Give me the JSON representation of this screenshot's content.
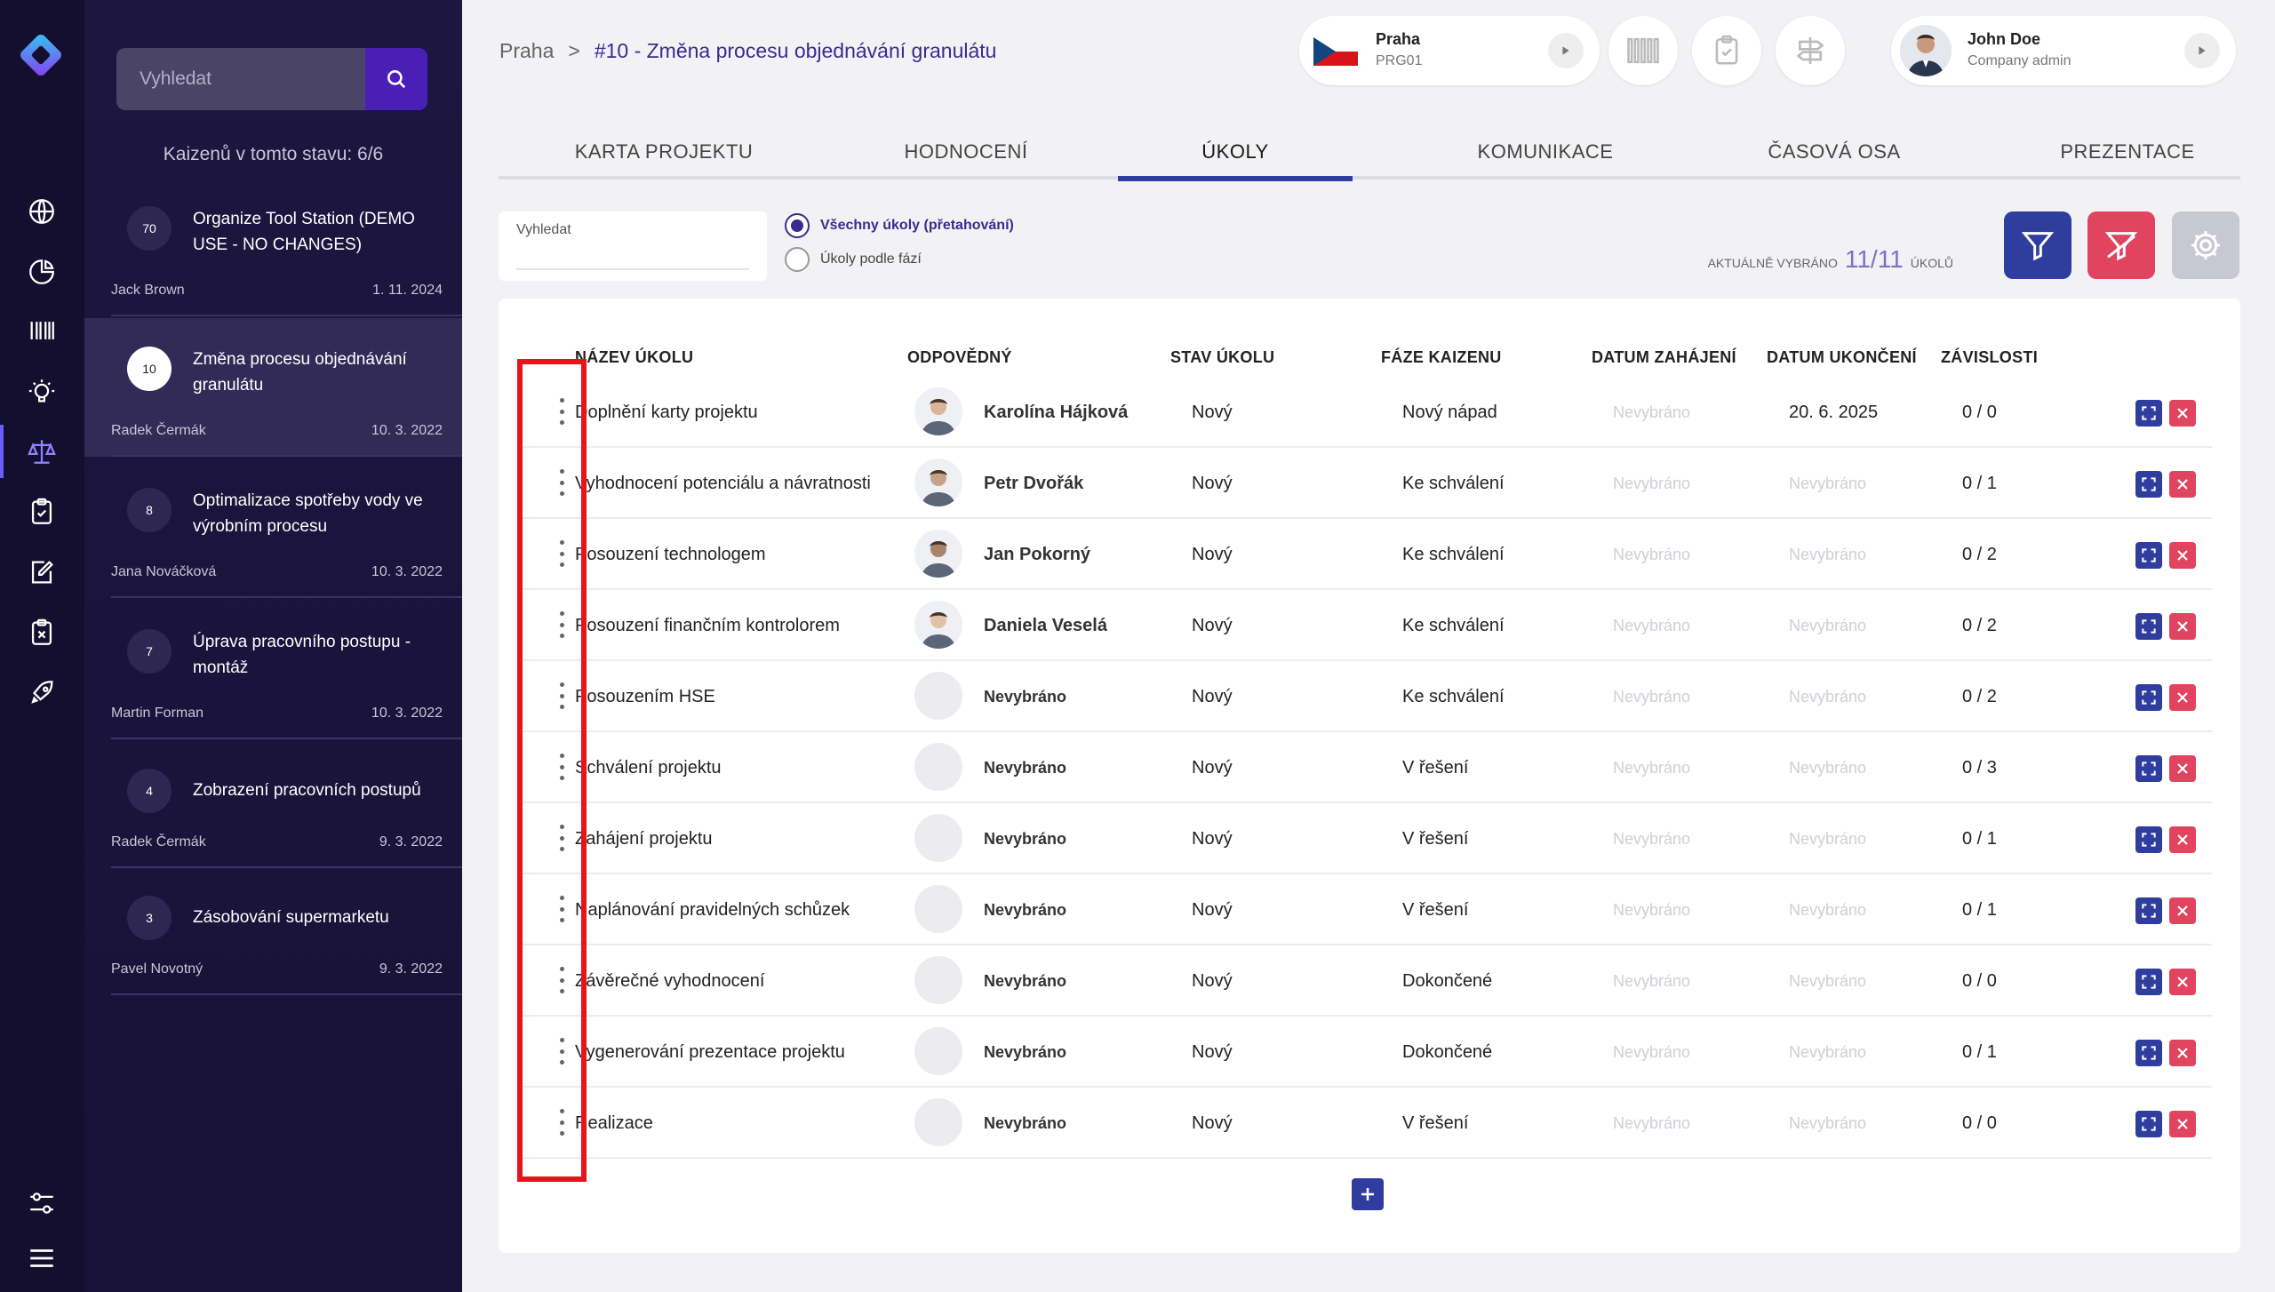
{
  "sidebar": {
    "search_placeholder": "Vyhledat",
    "count_text": "Kaizenů v tomto stavu: 6/6",
    "items": [
      {
        "number": "70",
        "title": "Organize Tool Station (DEMO USE - NO CHANGES)",
        "author": "Jack Brown",
        "date": "1. 11. 2024",
        "active": false
      },
      {
        "number": "10",
        "title": "Změna procesu objednávání granulátu",
        "author": "Radek Čermák",
        "date": "10. 3. 2022",
        "active": true
      },
      {
        "number": "8",
        "title": "Optimalizace spotřeby vody ve výrobním procesu",
        "author": "Jana Nováčková",
        "date": "10. 3. 2022",
        "active": false
      },
      {
        "number": "7",
        "title": "Úprava pracovního postupu - montáž",
        "author": "Martin Forman",
        "date": "10. 3. 2022",
        "active": false
      },
      {
        "number": "4",
        "title": "Zobrazení pracovních postupů",
        "author": "Radek Čermák",
        "date": "9. 3. 2022",
        "active": false
      },
      {
        "number": "3",
        "title": "Zásobování supermarketu",
        "author": "Pavel Novotný",
        "date": "9. 3. 2022",
        "active": false
      }
    ]
  },
  "header": {
    "breadcrumb_root": "Praha",
    "breadcrumb_sep": ">",
    "breadcrumb_current": "#10 - Změna procesu objednávání granulátu",
    "site_name": "Praha",
    "site_code": "PRG01",
    "user_name": "John Doe",
    "user_role": "Company admin"
  },
  "tabs": [
    "KARTA PROJEKTU",
    "HODNOCENÍ",
    "ÚKOLY",
    "KOMUNIKACE",
    "ČASOVÁ OSA",
    "PREZENTACE"
  ],
  "active_tab": "ÚKOLY",
  "filters": {
    "search_label": "Vyhledat",
    "radio_all": "Všechny úkoly (přetahování)",
    "radio_phases": "Úkoly podle fází",
    "selected_prefix": "AKTUÁLNĚ VYBRÁNO",
    "selected_count": "11/11",
    "selected_suffix": "ÚKOLŮ"
  },
  "table": {
    "headers": {
      "name": "NÁZEV ÚKOLU",
      "owner": "ODPOVĚDNÝ",
      "state": "STAV ÚKOLU",
      "phase": "FÁZE KAIZENU",
      "start": "DATUM ZAHÁJENÍ",
      "end": "DATUM UKONČENÍ",
      "deps": "ZÁVISLOSTI"
    },
    "rows": [
      {
        "name": "Doplnění karty projektu",
        "owner": "Karolína Hájková",
        "state": "Nový",
        "phase": "Nový nápad",
        "start": "Nevybráno",
        "end": "20. 6. 2025",
        "deps": "0 / 0"
      },
      {
        "name": "Vyhodnocení potenciálu a návratnosti",
        "owner": "Petr Dvořák",
        "state": "Nový",
        "phase": "Ke schválení",
        "start": "Nevybráno",
        "end": "Nevybráno",
        "deps": "0 / 1"
      },
      {
        "name": "Posouzení technologem",
        "owner": "Jan Pokorný",
        "state": "Nový",
        "phase": "Ke schválení",
        "start": "Nevybráno",
        "end": "Nevybráno",
        "deps": "0 / 2"
      },
      {
        "name": "Posouzení finančním kontrolorem",
        "owner": "Daniela Veselá",
        "state": "Nový",
        "phase": "Ke schválení",
        "start": "Nevybráno",
        "end": "Nevybráno",
        "deps": "0 / 2"
      },
      {
        "name": "Posouzením HSE",
        "owner": "Nevybráno",
        "state": "Nový",
        "phase": "Ke schválení",
        "start": "Nevybráno",
        "end": "Nevybráno",
        "deps": "0 / 2"
      },
      {
        "name": "Schválení projektu",
        "owner": "Nevybráno",
        "state": "Nový",
        "phase": "V řešení",
        "start": "Nevybráno",
        "end": "Nevybráno",
        "deps": "0 / 3"
      },
      {
        "name": "Zahájení projektu",
        "owner": "Nevybráno",
        "state": "Nový",
        "phase": "V řešení",
        "start": "Nevybráno",
        "end": "Nevybráno",
        "deps": "0 / 1"
      },
      {
        "name": "Naplánování pravidelných schůzek",
        "owner": "Nevybráno",
        "state": "Nový",
        "phase": "V řešení",
        "start": "Nevybráno",
        "end": "Nevybráno",
        "deps": "0 / 1"
      },
      {
        "name": "Závěrečné vyhodnocení",
        "owner": "Nevybráno",
        "state": "Nový",
        "phase": "Dokončené",
        "start": "Nevybráno",
        "end": "Nevybráno",
        "deps": "0 / 0"
      },
      {
        "name": "Vygenerování prezentace projektu",
        "owner": "Nevybráno",
        "state": "Nový",
        "phase": "Dokončené",
        "start": "Nevybráno",
        "end": "Nevybráno",
        "deps": "0 / 1"
      },
      {
        "name": "Realizace",
        "owner": "Nevybráno",
        "state": "Nový",
        "phase": "V řešení",
        "start": "Nevybráno",
        "end": "Nevybráno",
        "deps": "0 / 0"
      }
    ]
  },
  "colors": {
    "primary": "#2f3e9e",
    "danger": "#e0445f",
    "highlight": "#e8141b",
    "sidebar_bg": "#181238"
  }
}
